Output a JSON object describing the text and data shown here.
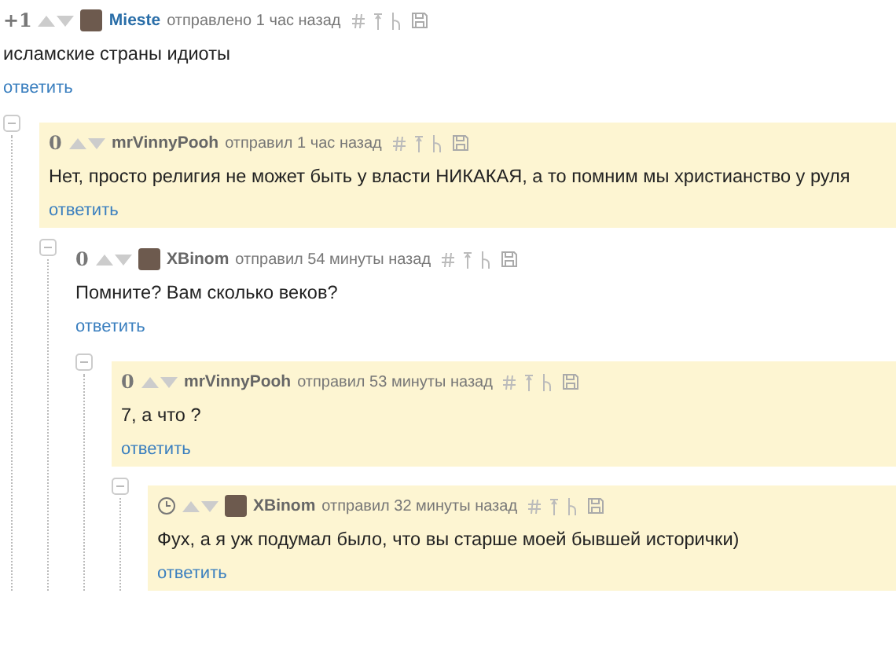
{
  "comment": {
    "score": "+1",
    "has_avatar": true,
    "author": "Mieste",
    "meta": "отправлено 1 час назад",
    "highlighted": false,
    "text": "исламские страны идиоты",
    "reply": "ответить",
    "children": [
      {
        "score": "0",
        "has_avatar": false,
        "author": "mrVinnyPooh",
        "meta": "отправил 1 час назад",
        "highlighted": true,
        "text": "Нет, просто религия не может быть у власти НИКАКАЯ, а то помним мы христианство у руля",
        "reply": "ответить",
        "children": [
          {
            "score": "0",
            "has_avatar": true,
            "author": "XBinom",
            "meta": "отправил 54 минуты назад",
            "highlighted": false,
            "text": "Помните? Вам сколько веков?",
            "reply": "ответить",
            "children": [
              {
                "score": "0",
                "has_avatar": false,
                "author": "mrVinnyPooh",
                "meta": "отправил 53 минуты назад",
                "highlighted": true,
                "text": "7, а что ?",
                "reply": "ответить",
                "children": [
                  {
                    "has_avatar": true,
                    "author": "XBinom",
                    "meta": "отправил 32 минуты назад",
                    "highlighted": true,
                    "text": "Фух, а я уж подумал было, что вы старше моей бывшей исторички)",
                    "reply": "ответить"
                  }
                ]
              }
            ]
          }
        ]
      }
    ]
  }
}
